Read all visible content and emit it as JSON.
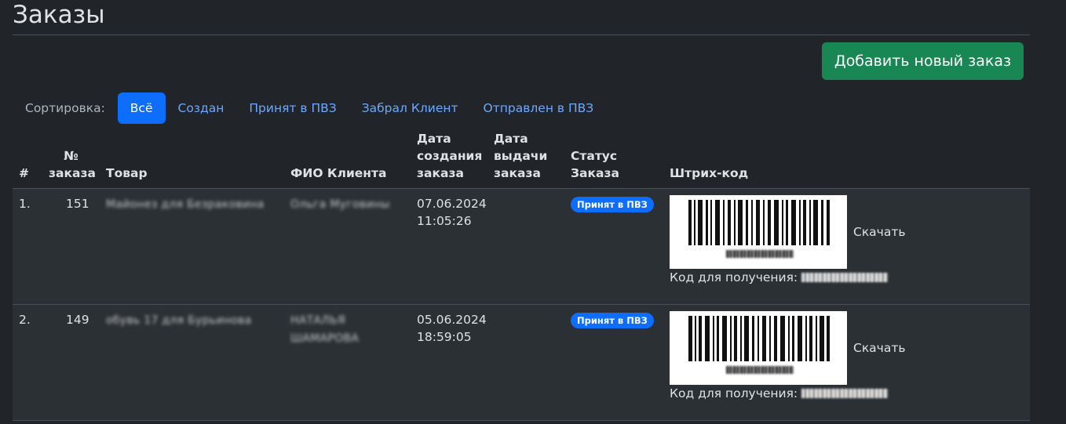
{
  "page": {
    "title": "Заказы"
  },
  "toolbar": {
    "add_button_label": "Добавить новый заказ"
  },
  "sort": {
    "label": "Сортировка:",
    "options": [
      {
        "label": "Всё",
        "active": true
      },
      {
        "label": "Создан",
        "active": false
      },
      {
        "label": "Принят в ПВЗ",
        "active": false
      },
      {
        "label": "Забрал Клиент",
        "active": false
      },
      {
        "label": "Отправлен в ПВЗ",
        "active": false
      }
    ]
  },
  "table": {
    "headers": {
      "num": "#",
      "order_no_line1": "№",
      "order_no_line2": "заказа",
      "product": "Товар",
      "client": "ФИО Клиента",
      "created_line1": "Дата",
      "created_line2": "создания",
      "created_line3": "заказа",
      "issued_line1": "Дата",
      "issued_line2": "выдачи",
      "issued_line3": "заказа",
      "status_line1": "Статус",
      "status_line2": "Заказа",
      "barcode": "Штрих-код"
    },
    "rows": [
      {
        "index": "1.",
        "order_no": "151",
        "product": "Майонез для Безраковина",
        "client_line1": "Ольга Муговины",
        "client_line2": "",
        "created_date": "07.06.2024",
        "created_time": "11:05:26",
        "issued": "",
        "status": "Принят в ПВЗ",
        "download_label": "Скачать",
        "pickup_label": "Код для получения:"
      },
      {
        "index": "2.",
        "order_no": "149",
        "product": "обувь 17 для Бурьинова",
        "client_line1": "НАТАЛЬЯ",
        "client_line2": "ШАМАРОВА",
        "created_date": "05.06.2024",
        "created_time": "18:59:05",
        "issued": "",
        "status": "Принят в ПВЗ",
        "download_label": "Скачать",
        "pickup_label": "Код для получения:"
      }
    ]
  },
  "colors": {
    "background": "#212529",
    "row_background": "#2b3035",
    "primary": "#0d6efd",
    "success": "#198754",
    "link": "#6ea8fe"
  }
}
